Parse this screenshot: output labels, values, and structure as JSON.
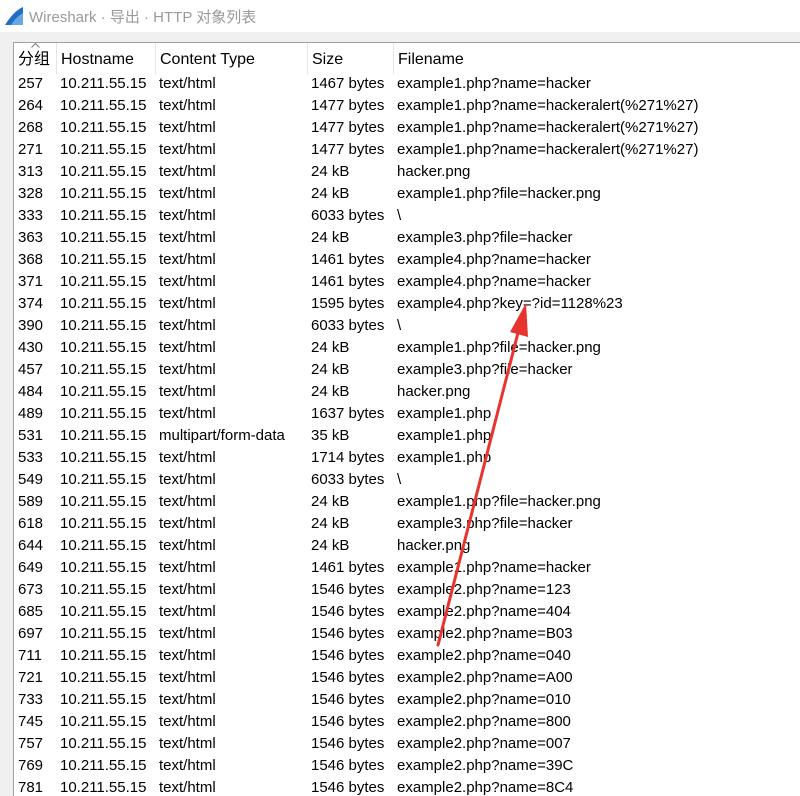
{
  "window": {
    "title": "Wireshark · 导出 · HTTP 对象列表",
    "colors": {
      "title_text": "#9a9a9a",
      "icon_blue": "#1f6fc5",
      "annotation_red": "#e8342f"
    }
  },
  "table": {
    "columns": [
      "分组",
      "Hostname",
      "Content Type",
      "Size",
      "Filename"
    ],
    "rows": [
      [
        "257",
        "10.211.55.15",
        "text/html",
        "1467 bytes",
        "example1.php?name=hacker"
      ],
      [
        "264",
        "10.211.55.15",
        "text/html",
        "1477 bytes",
        "example1.php?name=hackeralert(%271%27)"
      ],
      [
        "268",
        "10.211.55.15",
        "text/html",
        "1477 bytes",
        "example1.php?name=hackeralert(%271%27)"
      ],
      [
        "271",
        "10.211.55.15",
        "text/html",
        "1477 bytes",
        "example1.php?name=hackeralert(%271%27)"
      ],
      [
        "313",
        "10.211.55.15",
        "text/html",
        "24 kB",
        "hacker.png"
      ],
      [
        "328",
        "10.211.55.15",
        "text/html",
        "24 kB",
        "example1.php?file=hacker.png"
      ],
      [
        "333",
        "10.211.55.15",
        "text/html",
        "6033 bytes",
        "\\"
      ],
      [
        "363",
        "10.211.55.15",
        "text/html",
        "24 kB",
        "example3.php?file=hacker"
      ],
      [
        "368",
        "10.211.55.15",
        "text/html",
        "1461 bytes",
        "example4.php?name=hacker"
      ],
      [
        "371",
        "10.211.55.15",
        "text/html",
        "1461 bytes",
        "example4.php?name=hacker"
      ],
      [
        "374",
        "10.211.55.15",
        "text/html",
        "1595 bytes",
        "example4.php?key=?id=1128%23"
      ],
      [
        "390",
        "10.211.55.15",
        "text/html",
        "6033 bytes",
        "\\"
      ],
      [
        "430",
        "10.211.55.15",
        "text/html",
        "24 kB",
        "example1.php?file=hacker.png"
      ],
      [
        "457",
        "10.211.55.15",
        "text/html",
        "24 kB",
        "example3.php?file=hacker"
      ],
      [
        "484",
        "10.211.55.15",
        "text/html",
        "24 kB",
        "hacker.png"
      ],
      [
        "489",
        "10.211.55.15",
        "text/html",
        "1637 bytes",
        "example1.php"
      ],
      [
        "531",
        "10.211.55.15",
        "multipart/form-data",
        "35 kB",
        "example1.php"
      ],
      [
        "533",
        "10.211.55.15",
        "text/html",
        "1714 bytes",
        "example1.php"
      ],
      [
        "549",
        "10.211.55.15",
        "text/html",
        "6033 bytes",
        "\\"
      ],
      [
        "589",
        "10.211.55.15",
        "text/html",
        "24 kB",
        "example1.php?file=hacker.png"
      ],
      [
        "618",
        "10.211.55.15",
        "text/html",
        "24 kB",
        "example3.php?file=hacker"
      ],
      [
        "644",
        "10.211.55.15",
        "text/html",
        "24 kB",
        "hacker.png"
      ],
      [
        "649",
        "10.211.55.15",
        "text/html",
        "1461 bytes",
        "example1.php?name=hacker"
      ],
      [
        "673",
        "10.211.55.15",
        "text/html",
        "1546 bytes",
        "example2.php?name=123"
      ],
      [
        "685",
        "10.211.55.15",
        "text/html",
        "1546 bytes",
        "example2.php?name=404"
      ],
      [
        "697",
        "10.211.55.15",
        "text/html",
        "1546 bytes",
        "example2.php?name=B03"
      ],
      [
        "711",
        "10.211.55.15",
        "text/html",
        "1546 bytes",
        "example2.php?name=040"
      ],
      [
        "721",
        "10.211.55.15",
        "text/html",
        "1546 bytes",
        "example2.php?name=A00"
      ],
      [
        "733",
        "10.211.55.15",
        "text/html",
        "1546 bytes",
        "example2.php?name=010"
      ],
      [
        "745",
        "10.211.55.15",
        "text/html",
        "1546 bytes",
        "example2.php?name=800"
      ],
      [
        "757",
        "10.211.55.15",
        "text/html",
        "1546 bytes",
        "example2.php?name=007"
      ],
      [
        "769",
        "10.211.55.15",
        "text/html",
        "1546 bytes",
        "example2.php?name=39C"
      ],
      [
        "781",
        "10.211.55.15",
        "text/html",
        "1546 bytes",
        "example2.php?name=8C4"
      ]
    ]
  },
  "icons": {
    "app": "wireshark-fin-icon",
    "sort": "sort-ascending-icon"
  },
  "annotation": {
    "type": "red-arrow",
    "points_to_row": "374"
  }
}
